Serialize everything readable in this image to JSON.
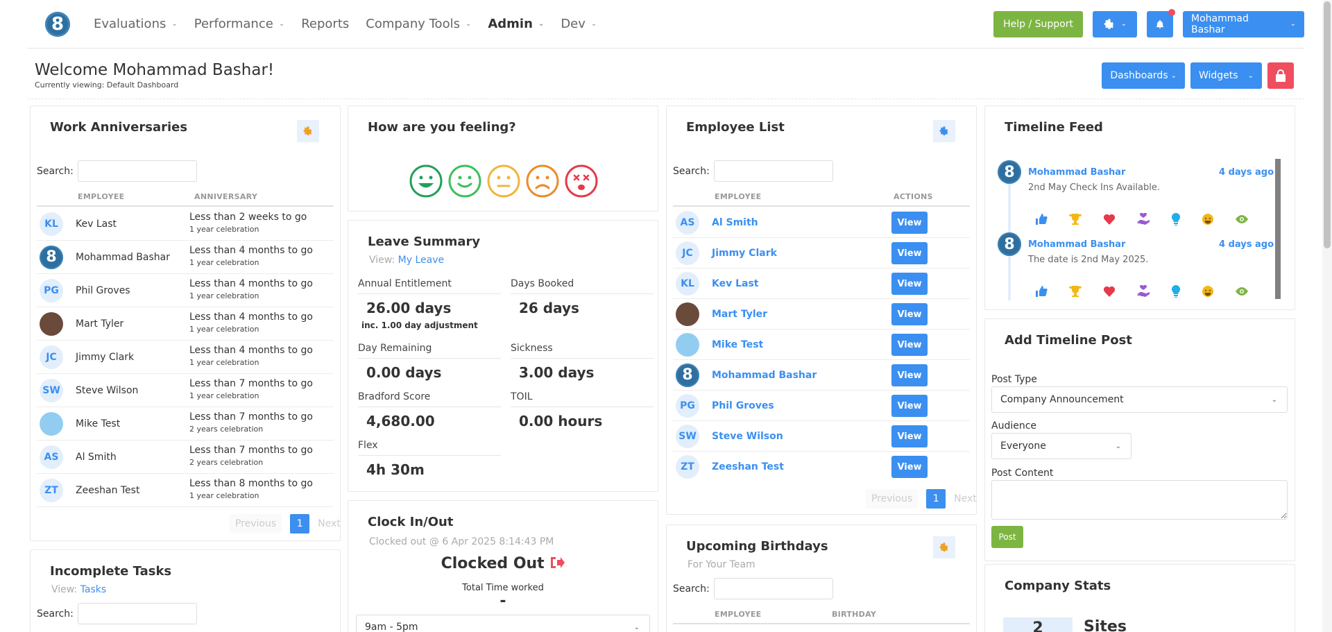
{
  "nav": {
    "items": [
      {
        "label": "Evaluations",
        "chevron": true
      },
      {
        "label": "Performance",
        "chevron": true
      },
      {
        "label": "Reports",
        "chevron": false
      },
      {
        "label": "Company Tools",
        "chevron": true
      },
      {
        "label": "Admin",
        "chevron": true
      },
      {
        "label": "Dev",
        "chevron": true
      }
    ],
    "help_label": "Help / Support",
    "user_label": "Mohammad Bashar"
  },
  "header": {
    "welcome": "Welcome Mohammad Bashar!",
    "viewing": "Currently viewing: Default Dashboard",
    "dashboards_label": "Dashboards",
    "widgets_label": "Widgets"
  },
  "anniversaries": {
    "title": "Work Anniversaries",
    "search_label": "Search:",
    "col_employee": "EMPLOYEE",
    "col_anniversary": "ANNIVERSARY",
    "rows": [
      {
        "initials": "KL",
        "name": "Kev Last",
        "when": "Less than 2 weeks to go",
        "celebration": "1 year celebration"
      },
      {
        "initials": "",
        "name": "Mohammad Bashar",
        "when": "Less than 4 months to go",
        "celebration": "1 year celebration"
      },
      {
        "initials": "PG",
        "name": "Phil Groves",
        "when": "Less than 4 months to go",
        "celebration": "1 year celebration"
      },
      {
        "initials": "",
        "name": "Mart Tyler",
        "when": "Less than 4 months to go",
        "celebration": "1 year celebration"
      },
      {
        "initials": "JC",
        "name": "Jimmy Clark",
        "when": "Less than 4 months to go",
        "celebration": "1 year celebration"
      },
      {
        "initials": "SW",
        "name": "Steve Wilson",
        "when": "Less than 7 months to go",
        "celebration": "1 year celebration"
      },
      {
        "initials": "",
        "name": "Mike Test",
        "when": "Less than 7 months to go",
        "celebration": "2 years celebration"
      },
      {
        "initials": "AS",
        "name": "Al Smith",
        "when": "Less than 7 months to go",
        "celebration": "2 years celebration"
      },
      {
        "initials": "ZT",
        "name": "Zeeshan Test",
        "when": "Less than 8 months to go",
        "celebration": "1 year celebration"
      }
    ],
    "prev": "Previous",
    "page": "1",
    "next": "Next"
  },
  "tasks": {
    "title": "Incomplete Tasks",
    "view_prefix": "View:",
    "view_link": "Tasks",
    "search_label": "Search:"
  },
  "feeling": {
    "title": "How are you feeling?"
  },
  "leave": {
    "title": "Leave Summary",
    "view_prefix": "View:",
    "view_link": "My Leave",
    "annual_label": "Annual Entitlement",
    "annual_value": "26.00 days",
    "annual_note": "inc. 1.00 day adjustment",
    "booked_label": "Days Booked",
    "booked_value": "26 days",
    "remaining_label": "Day Remaining",
    "remaining_value": "0.00 days",
    "sickness_label": "Sickness",
    "sickness_value": "3.00 days",
    "bradford_label": "Bradford Score",
    "bradford_value": "4,680.00",
    "toil_label": "TOIL",
    "toil_value": "0.00 hours",
    "flex_label": "Flex",
    "flex_value": "4h 30m"
  },
  "clock": {
    "title": "Clock In/Out",
    "subtitle": "Clocked out @ 6 Apr 2025 8:14:43 PM",
    "status": "Clocked Out",
    "total_label": "Total Time worked",
    "total_value": "-",
    "shift": "9am - 5pm"
  },
  "employees": {
    "title": "Employee List",
    "search_label": "Search:",
    "col_employee": "EMPLOYEE",
    "col_actions": "ACTIONS",
    "view_label": "View",
    "rows": [
      {
        "initials": "AS",
        "name": "Al Smith"
      },
      {
        "initials": "JC",
        "name": "Jimmy Clark"
      },
      {
        "initials": "KL",
        "name": "Kev Last"
      },
      {
        "initials": "",
        "name": "Mart Tyler"
      },
      {
        "initials": "",
        "name": "Mike Test"
      },
      {
        "initials": "",
        "name": "Mohammad Bashar"
      },
      {
        "initials": "PG",
        "name": "Phil Groves"
      },
      {
        "initials": "SW",
        "name": "Steve Wilson"
      },
      {
        "initials": "ZT",
        "name": "Zeeshan Test"
      }
    ],
    "prev": "Previous",
    "page": "1",
    "next": "Next"
  },
  "birthdays": {
    "title": "Upcoming Birthdays",
    "subtitle": "For Your Team",
    "search_label": "Search:",
    "col_employee": "EMPLOYEE",
    "col_birthday": "BIRTHDAY"
  },
  "timeline": {
    "title": "Timeline Feed",
    "items": [
      {
        "author": "Mohammad Bashar",
        "time": "4 days ago",
        "text": "2nd May Check Ins Available."
      },
      {
        "author": "Mohammad Bashar",
        "time": "4 days ago",
        "text": "The date is 2nd May 2025."
      }
    ]
  },
  "post": {
    "title": "Add Timeline Post",
    "type_label": "Post Type",
    "type_value": "Company Announcement",
    "audience_label": "Audience",
    "audience_value": "Everyone",
    "content_label": "Post Content",
    "submit_label": "Post"
  },
  "stats": {
    "title": "Company Stats",
    "sites_count": "2",
    "sites_label": "Sites"
  },
  "colors": {
    "accent": "#3b8ff0",
    "green": "#7db542",
    "red": "#ee4e5e"
  }
}
